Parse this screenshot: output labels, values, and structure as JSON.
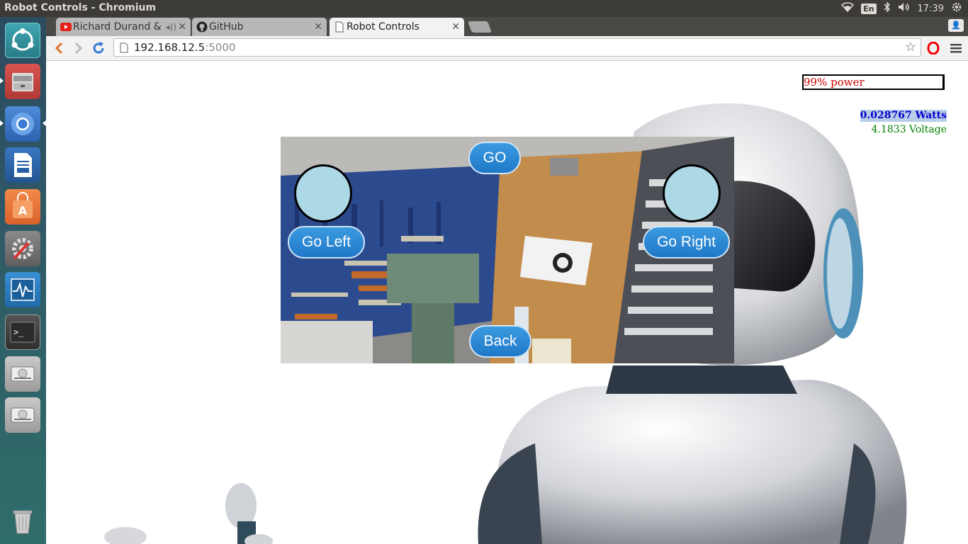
{
  "system_bar": {
    "window_title": "Robot Controls - Chromium",
    "language": "En",
    "clock": "17:39"
  },
  "launcher": {
    "items": [
      "ubuntu-dash-icon",
      "files-icon",
      "chromium-icon",
      "writer-icon",
      "software-center-icon",
      "system-settings-icon",
      "system-monitor-icon",
      "terminal-icon",
      "drive-icon",
      "drive-icon",
      "trash-icon"
    ]
  },
  "browser": {
    "tabs": [
      {
        "label": "Richard Durand &",
        "icon": "youtube-icon"
      },
      {
        "label": "GitHub",
        "icon": "github-icon"
      },
      {
        "label": "Robot Controls",
        "icon": "page-icon"
      }
    ],
    "url_host": "192.168.12.5",
    "url_port": ":5000"
  },
  "page": {
    "power_label": "99% power",
    "watts_label": "0.028767 Watts",
    "voltage_label": "4.1833 Voltage",
    "buttons": {
      "go": "GO",
      "go_left": "Go Left",
      "go_right": "Go Right",
      "back": "Back"
    },
    "colors": {
      "button": "#2a8ad6",
      "joystick": "#add8e6",
      "power_text": "#cc0000",
      "watts_text": "#0000cc",
      "voltage_text": "#008000"
    }
  }
}
